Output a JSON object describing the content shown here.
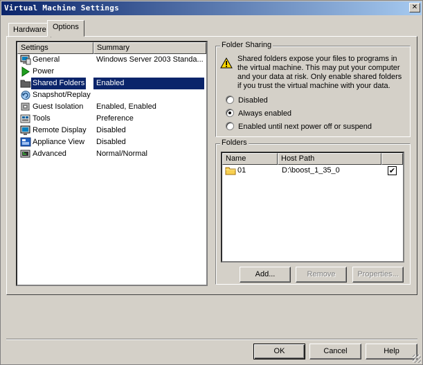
{
  "window": {
    "title": "Virtual Machine Settings",
    "close_glyph": "✕"
  },
  "tabs": [
    {
      "label": "Hardware",
      "selected": false
    },
    {
      "label": "Options",
      "selected": true
    }
  ],
  "settings_list": {
    "headers": [
      "Settings",
      "Summary"
    ],
    "rows": [
      {
        "name": "General",
        "summary": "Windows Server 2003 Standa...",
        "icon": "monitor-icon",
        "selected": false
      },
      {
        "name": "Power",
        "summary": "",
        "icon": "play-icon",
        "selected": false
      },
      {
        "name": "Shared Folders",
        "summary": "Enabled",
        "icon": "folder-icon",
        "selected": true
      },
      {
        "name": "Snapshot/Replay",
        "summary": "",
        "icon": "snapshot-icon",
        "selected": false
      },
      {
        "name": "Guest Isolation",
        "summary": "Enabled, Enabled",
        "icon": "isolation-icon",
        "selected": false
      },
      {
        "name": "Tools",
        "summary": "Preference",
        "icon": "tools-icon",
        "selected": false
      },
      {
        "name": "Remote Display",
        "summary": "Disabled",
        "icon": "remote-display-icon",
        "selected": false
      },
      {
        "name": "Appliance View",
        "summary": "Disabled",
        "icon": "appliance-icon",
        "selected": false
      },
      {
        "name": "Advanced",
        "summary": "Normal/Normal",
        "icon": "advanced-icon",
        "selected": false
      }
    ]
  },
  "folder_sharing": {
    "title": "Folder Sharing",
    "warning": "Shared folders expose your files to programs in the virtual machine. This may put your computer and your data at risk. Only enable shared folders if you trust the virtual machine with your data.",
    "options": [
      {
        "label": "Disabled",
        "checked": false
      },
      {
        "label": "Always enabled",
        "checked": true
      },
      {
        "label": "Enabled until next power off or suspend",
        "checked": false
      }
    ]
  },
  "folders": {
    "title": "Folders",
    "headers": [
      "Name",
      "Host Path"
    ],
    "rows": [
      {
        "name": "01",
        "host_path": "D:\\boost_1_35_0",
        "enabled": true,
        "check_glyph": "✔"
      }
    ],
    "buttons": {
      "add": "Add...",
      "remove": "Remove",
      "properties": "Properties..."
    }
  },
  "footer": {
    "ok": "OK",
    "cancel": "Cancel",
    "help": "Help"
  },
  "colors": {
    "selection": "#0a246a",
    "face": "#d4d0c8",
    "title_start": "#0a246a",
    "title_end": "#a6caf0"
  }
}
